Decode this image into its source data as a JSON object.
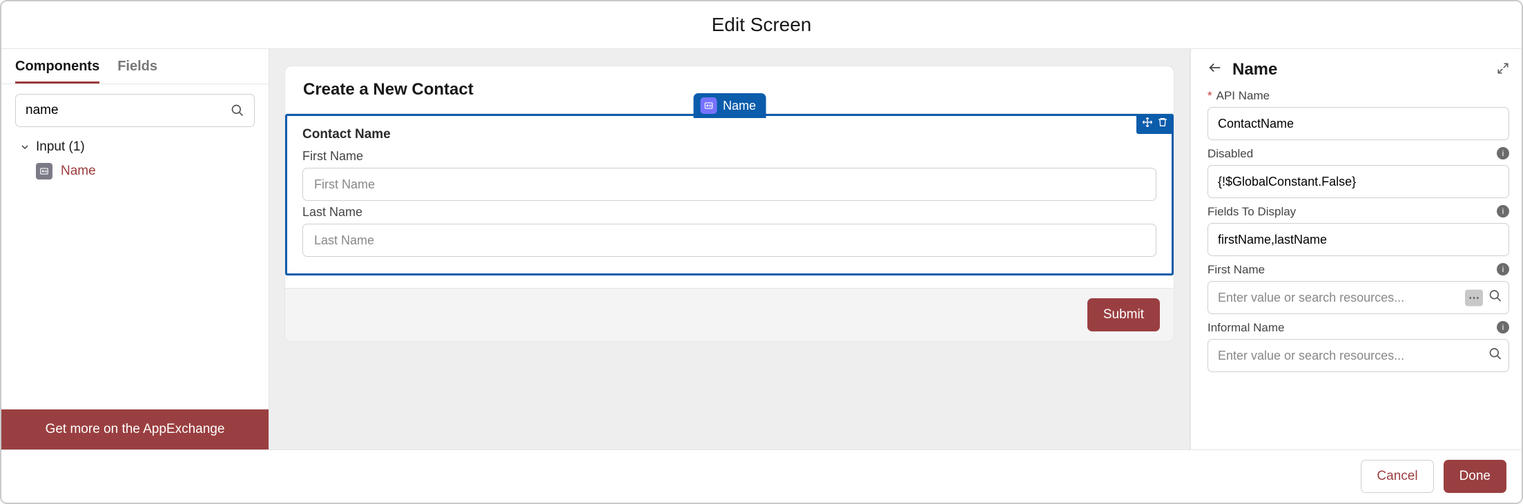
{
  "header": {
    "title": "Edit Screen"
  },
  "sidebar": {
    "tabs": [
      "Components",
      "Fields"
    ],
    "active_tab": 0,
    "search_value": "name",
    "tree": {
      "group_label": "Input (1)",
      "items": [
        {
          "icon": "name-component-icon",
          "label": "Name"
        }
      ]
    },
    "appexchange_label": "Get more on the AppExchange"
  },
  "canvas": {
    "screen_title": "Create a New Contact",
    "selected_pill_label": "Name",
    "block_label": "Contact Name",
    "fields": [
      {
        "label": "First Name",
        "placeholder": "First Name"
      },
      {
        "label": "Last Name",
        "placeholder": "Last Name"
      }
    ],
    "submit_label": "Submit"
  },
  "props": {
    "title": "Name",
    "api_name_label": "API Name",
    "api_name_value": "ContactName",
    "disabled_label": "Disabled",
    "disabled_value": "{!$GlobalConstant.False}",
    "fields_to_display_label": "Fields To Display",
    "fields_to_display_value": "firstName,lastName",
    "first_name_label": "First Name",
    "first_name_placeholder": "Enter value or search resources...",
    "informal_name_label": "Informal Name",
    "informal_name_placeholder": "Enter value or search resources..."
  },
  "footer": {
    "cancel_label": "Cancel",
    "done_label": "Done"
  }
}
